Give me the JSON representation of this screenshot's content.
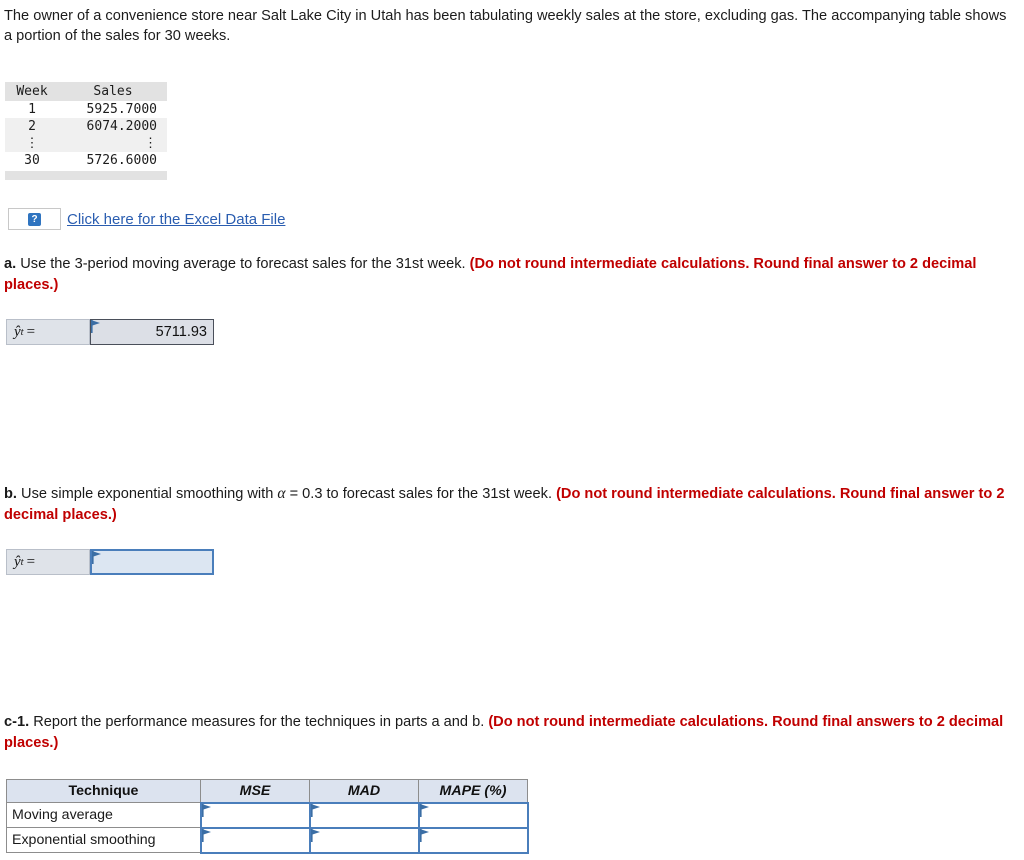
{
  "intro": {
    "paragraph": "The owner of a convenience store near Salt Lake City in Utah has been tabulating weekly sales at the store, excluding gas. The accompanying table shows a portion of the sales for 30 weeks."
  },
  "data_table": {
    "headers": [
      "Week",
      "Sales"
    ],
    "rows": [
      {
        "week": "1",
        "sales": "5925.7000"
      },
      {
        "week": "2",
        "sales": "6074.2000"
      },
      {
        "week": "⋮",
        "sales": "⋮"
      },
      {
        "week": "30",
        "sales": "5726.6000"
      }
    ]
  },
  "excel": {
    "icon_glyph": "?",
    "link_label": "Click here for the Excel Data File"
  },
  "part_a": {
    "label": "a.",
    "prompt": " Use the 3-period moving average to forecast sales for the 31st week. ",
    "note": "(Do not round intermediate calculations. Round final answer to 2 decimal places.)",
    "answer_label_hat": "ŷ",
    "answer_label_sub": "t",
    "answer_label_eq": "=",
    "answer_value": "5711.93"
  },
  "part_b": {
    "label": "b.",
    "prompt_before_alpha": " Use simple exponential smoothing with ",
    "alpha_symbol": "α",
    "prompt_after_alpha": " = 0.3 to forecast sales for the 31st week. ",
    "note": "(Do not round intermediate calculations. Round final answer to 2 decimal places.)",
    "answer_label_hat": "ŷ",
    "answer_label_sub": "t",
    "answer_label_eq": "=",
    "answer_value": ""
  },
  "part_c1": {
    "label": "c-1.",
    "prompt": " Report the performance measures for the techniques in parts a and b. ",
    "note": "(Do not round intermediate calculations. Round final answers to 2 decimal places.)"
  },
  "perf_table": {
    "headers": [
      "Technique",
      "MSE",
      "MAD",
      "MAPE (%)"
    ],
    "rows": [
      {
        "technique": "Moving average",
        "mse": "",
        "mad": "",
        "mape": ""
      },
      {
        "technique": "Exponential smoothing",
        "mse": "",
        "mad": "",
        "mape": ""
      }
    ]
  },
  "colors": {
    "accent_blue": "#4a7ebb",
    "link_blue": "#2a5db0",
    "red_note": "#c00000",
    "header_fill": "#dce3ef",
    "input_fill": "#dce6f2"
  }
}
